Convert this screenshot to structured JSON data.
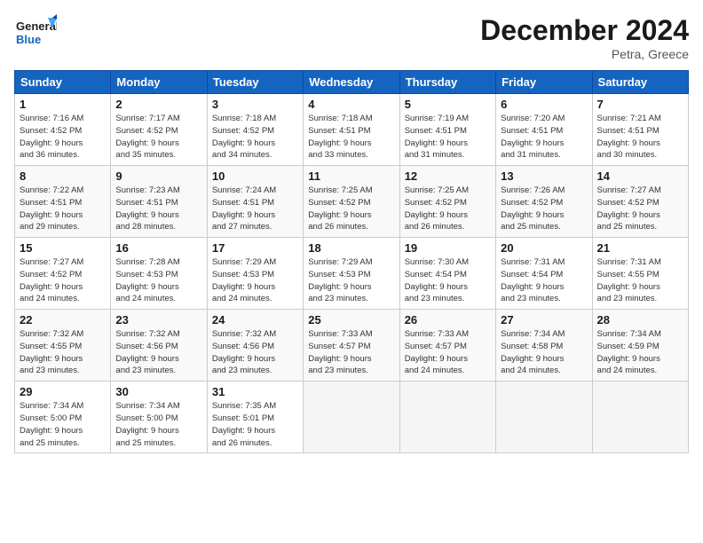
{
  "header": {
    "logo_line1": "General",
    "logo_line2": "Blue",
    "month": "December 2024",
    "location": "Petra, Greece"
  },
  "weekdays": [
    "Sunday",
    "Monday",
    "Tuesday",
    "Wednesday",
    "Thursday",
    "Friday",
    "Saturday"
  ],
  "weeks": [
    [
      {
        "day": "1",
        "info": "Sunrise: 7:16 AM\nSunset: 4:52 PM\nDaylight: 9 hours\nand 36 minutes."
      },
      {
        "day": "2",
        "info": "Sunrise: 7:17 AM\nSunset: 4:52 PM\nDaylight: 9 hours\nand 35 minutes."
      },
      {
        "day": "3",
        "info": "Sunrise: 7:18 AM\nSunset: 4:52 PM\nDaylight: 9 hours\nand 34 minutes."
      },
      {
        "day": "4",
        "info": "Sunrise: 7:18 AM\nSunset: 4:51 PM\nDaylight: 9 hours\nand 33 minutes."
      },
      {
        "day": "5",
        "info": "Sunrise: 7:19 AM\nSunset: 4:51 PM\nDaylight: 9 hours\nand 31 minutes."
      },
      {
        "day": "6",
        "info": "Sunrise: 7:20 AM\nSunset: 4:51 PM\nDaylight: 9 hours\nand 31 minutes."
      },
      {
        "day": "7",
        "info": "Sunrise: 7:21 AM\nSunset: 4:51 PM\nDaylight: 9 hours\nand 30 minutes."
      }
    ],
    [
      {
        "day": "8",
        "info": "Sunrise: 7:22 AM\nSunset: 4:51 PM\nDaylight: 9 hours\nand 29 minutes."
      },
      {
        "day": "9",
        "info": "Sunrise: 7:23 AM\nSunset: 4:51 PM\nDaylight: 9 hours\nand 28 minutes."
      },
      {
        "day": "10",
        "info": "Sunrise: 7:24 AM\nSunset: 4:51 PM\nDaylight: 9 hours\nand 27 minutes."
      },
      {
        "day": "11",
        "info": "Sunrise: 7:25 AM\nSunset: 4:52 PM\nDaylight: 9 hours\nand 26 minutes."
      },
      {
        "day": "12",
        "info": "Sunrise: 7:25 AM\nSunset: 4:52 PM\nDaylight: 9 hours\nand 26 minutes."
      },
      {
        "day": "13",
        "info": "Sunrise: 7:26 AM\nSunset: 4:52 PM\nDaylight: 9 hours\nand 25 minutes."
      },
      {
        "day": "14",
        "info": "Sunrise: 7:27 AM\nSunset: 4:52 PM\nDaylight: 9 hours\nand 25 minutes."
      }
    ],
    [
      {
        "day": "15",
        "info": "Sunrise: 7:27 AM\nSunset: 4:52 PM\nDaylight: 9 hours\nand 24 minutes."
      },
      {
        "day": "16",
        "info": "Sunrise: 7:28 AM\nSunset: 4:53 PM\nDaylight: 9 hours\nand 24 minutes."
      },
      {
        "day": "17",
        "info": "Sunrise: 7:29 AM\nSunset: 4:53 PM\nDaylight: 9 hours\nand 24 minutes."
      },
      {
        "day": "18",
        "info": "Sunrise: 7:29 AM\nSunset: 4:53 PM\nDaylight: 9 hours\nand 23 minutes."
      },
      {
        "day": "19",
        "info": "Sunrise: 7:30 AM\nSunset: 4:54 PM\nDaylight: 9 hours\nand 23 minutes."
      },
      {
        "day": "20",
        "info": "Sunrise: 7:31 AM\nSunset: 4:54 PM\nDaylight: 9 hours\nand 23 minutes."
      },
      {
        "day": "21",
        "info": "Sunrise: 7:31 AM\nSunset: 4:55 PM\nDaylight: 9 hours\nand 23 minutes."
      }
    ],
    [
      {
        "day": "22",
        "info": "Sunrise: 7:32 AM\nSunset: 4:55 PM\nDaylight: 9 hours\nand 23 minutes."
      },
      {
        "day": "23",
        "info": "Sunrise: 7:32 AM\nSunset: 4:56 PM\nDaylight: 9 hours\nand 23 minutes."
      },
      {
        "day": "24",
        "info": "Sunrise: 7:32 AM\nSunset: 4:56 PM\nDaylight: 9 hours\nand 23 minutes."
      },
      {
        "day": "25",
        "info": "Sunrise: 7:33 AM\nSunset: 4:57 PM\nDaylight: 9 hours\nand 23 minutes."
      },
      {
        "day": "26",
        "info": "Sunrise: 7:33 AM\nSunset: 4:57 PM\nDaylight: 9 hours\nand 24 minutes."
      },
      {
        "day": "27",
        "info": "Sunrise: 7:34 AM\nSunset: 4:58 PM\nDaylight: 9 hours\nand 24 minutes."
      },
      {
        "day": "28",
        "info": "Sunrise: 7:34 AM\nSunset: 4:59 PM\nDaylight: 9 hours\nand 24 minutes."
      }
    ],
    [
      {
        "day": "29",
        "info": "Sunrise: 7:34 AM\nSunset: 5:00 PM\nDaylight: 9 hours\nand 25 minutes."
      },
      {
        "day": "30",
        "info": "Sunrise: 7:34 AM\nSunset: 5:00 PM\nDaylight: 9 hours\nand 25 minutes."
      },
      {
        "day": "31",
        "info": "Sunrise: 7:35 AM\nSunset: 5:01 PM\nDaylight: 9 hours\nand 26 minutes."
      },
      {
        "day": "",
        "info": ""
      },
      {
        "day": "",
        "info": ""
      },
      {
        "day": "",
        "info": ""
      },
      {
        "day": "",
        "info": ""
      }
    ]
  ]
}
